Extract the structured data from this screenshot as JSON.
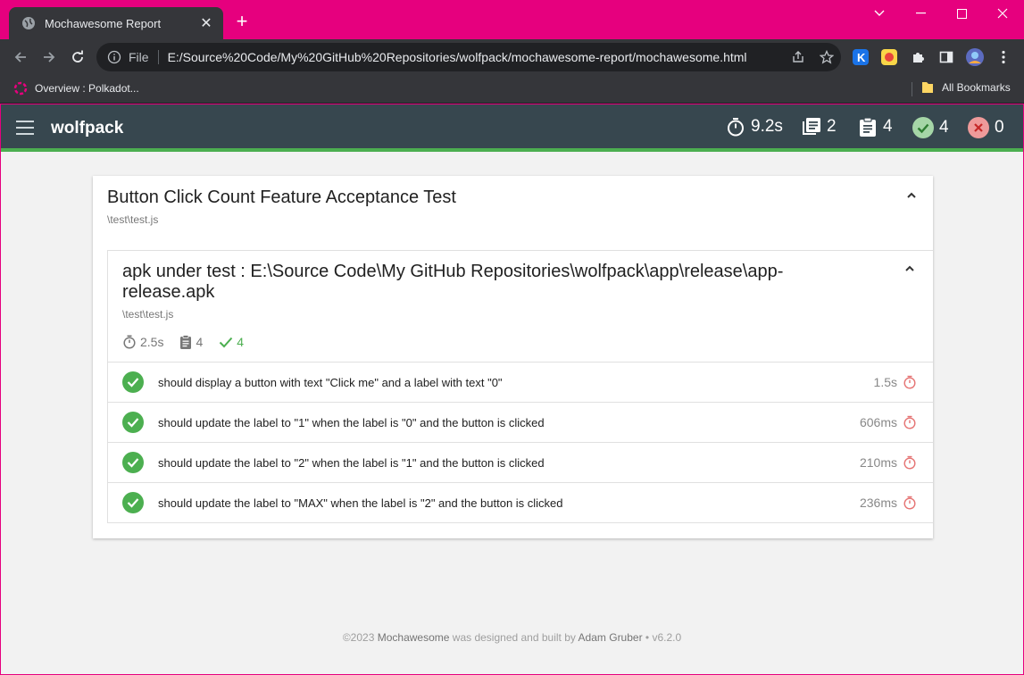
{
  "browser": {
    "tab_title": "Mochawesome Report",
    "omnibox_scheme": "File",
    "url": "E:/Source%20Code/My%20GitHub%20Repositories/wolfpack/mochawesome-report/mochawesome.html",
    "bookmarks": [
      {
        "label": "Overview : Polkadot..."
      },
      {
        "label": "All Bookmarks"
      }
    ],
    "colors": {
      "frame": "#e6007e",
      "toolbar": "#35363a"
    }
  },
  "report": {
    "title": "wolfpack",
    "stats": {
      "duration": "9.2s",
      "suites": "2",
      "tests": "4",
      "passes": "4",
      "failures": "0"
    },
    "colors": {
      "navbar": "#37474f",
      "pass": "#4caf50",
      "fail": "#f44336"
    }
  },
  "suite": {
    "title": "Button Click Count Feature Acceptance Test",
    "file": "\\test\\test.js",
    "child": {
      "title": "apk under test : E:\\Source Code\\My GitHub Repositories\\wolfpack\\app\\release\\app-release.apk",
      "file": "\\test\\test.js",
      "duration": "2.5s",
      "tests": "4",
      "passes": "4",
      "tests_list": [
        {
          "title": "should display a button with text \"Click me\" and a label with text \"0\"",
          "duration": "1.5s"
        },
        {
          "title": "should update the label to \"1\" when the label is \"0\" and the button is clicked",
          "duration": "606ms"
        },
        {
          "title": "should update the label to \"2\" when the label is \"1\" and the button is clicked",
          "duration": "210ms"
        },
        {
          "title": "should update the label to \"MAX\" when the label is \"2\" and the button is clicked",
          "duration": "236ms"
        }
      ]
    }
  },
  "footer": {
    "copyright": "©2023",
    "brand": "Mochawesome",
    "middle": "was designed and built by",
    "author": "Adam Gruber",
    "version": "• v6.2.0"
  }
}
